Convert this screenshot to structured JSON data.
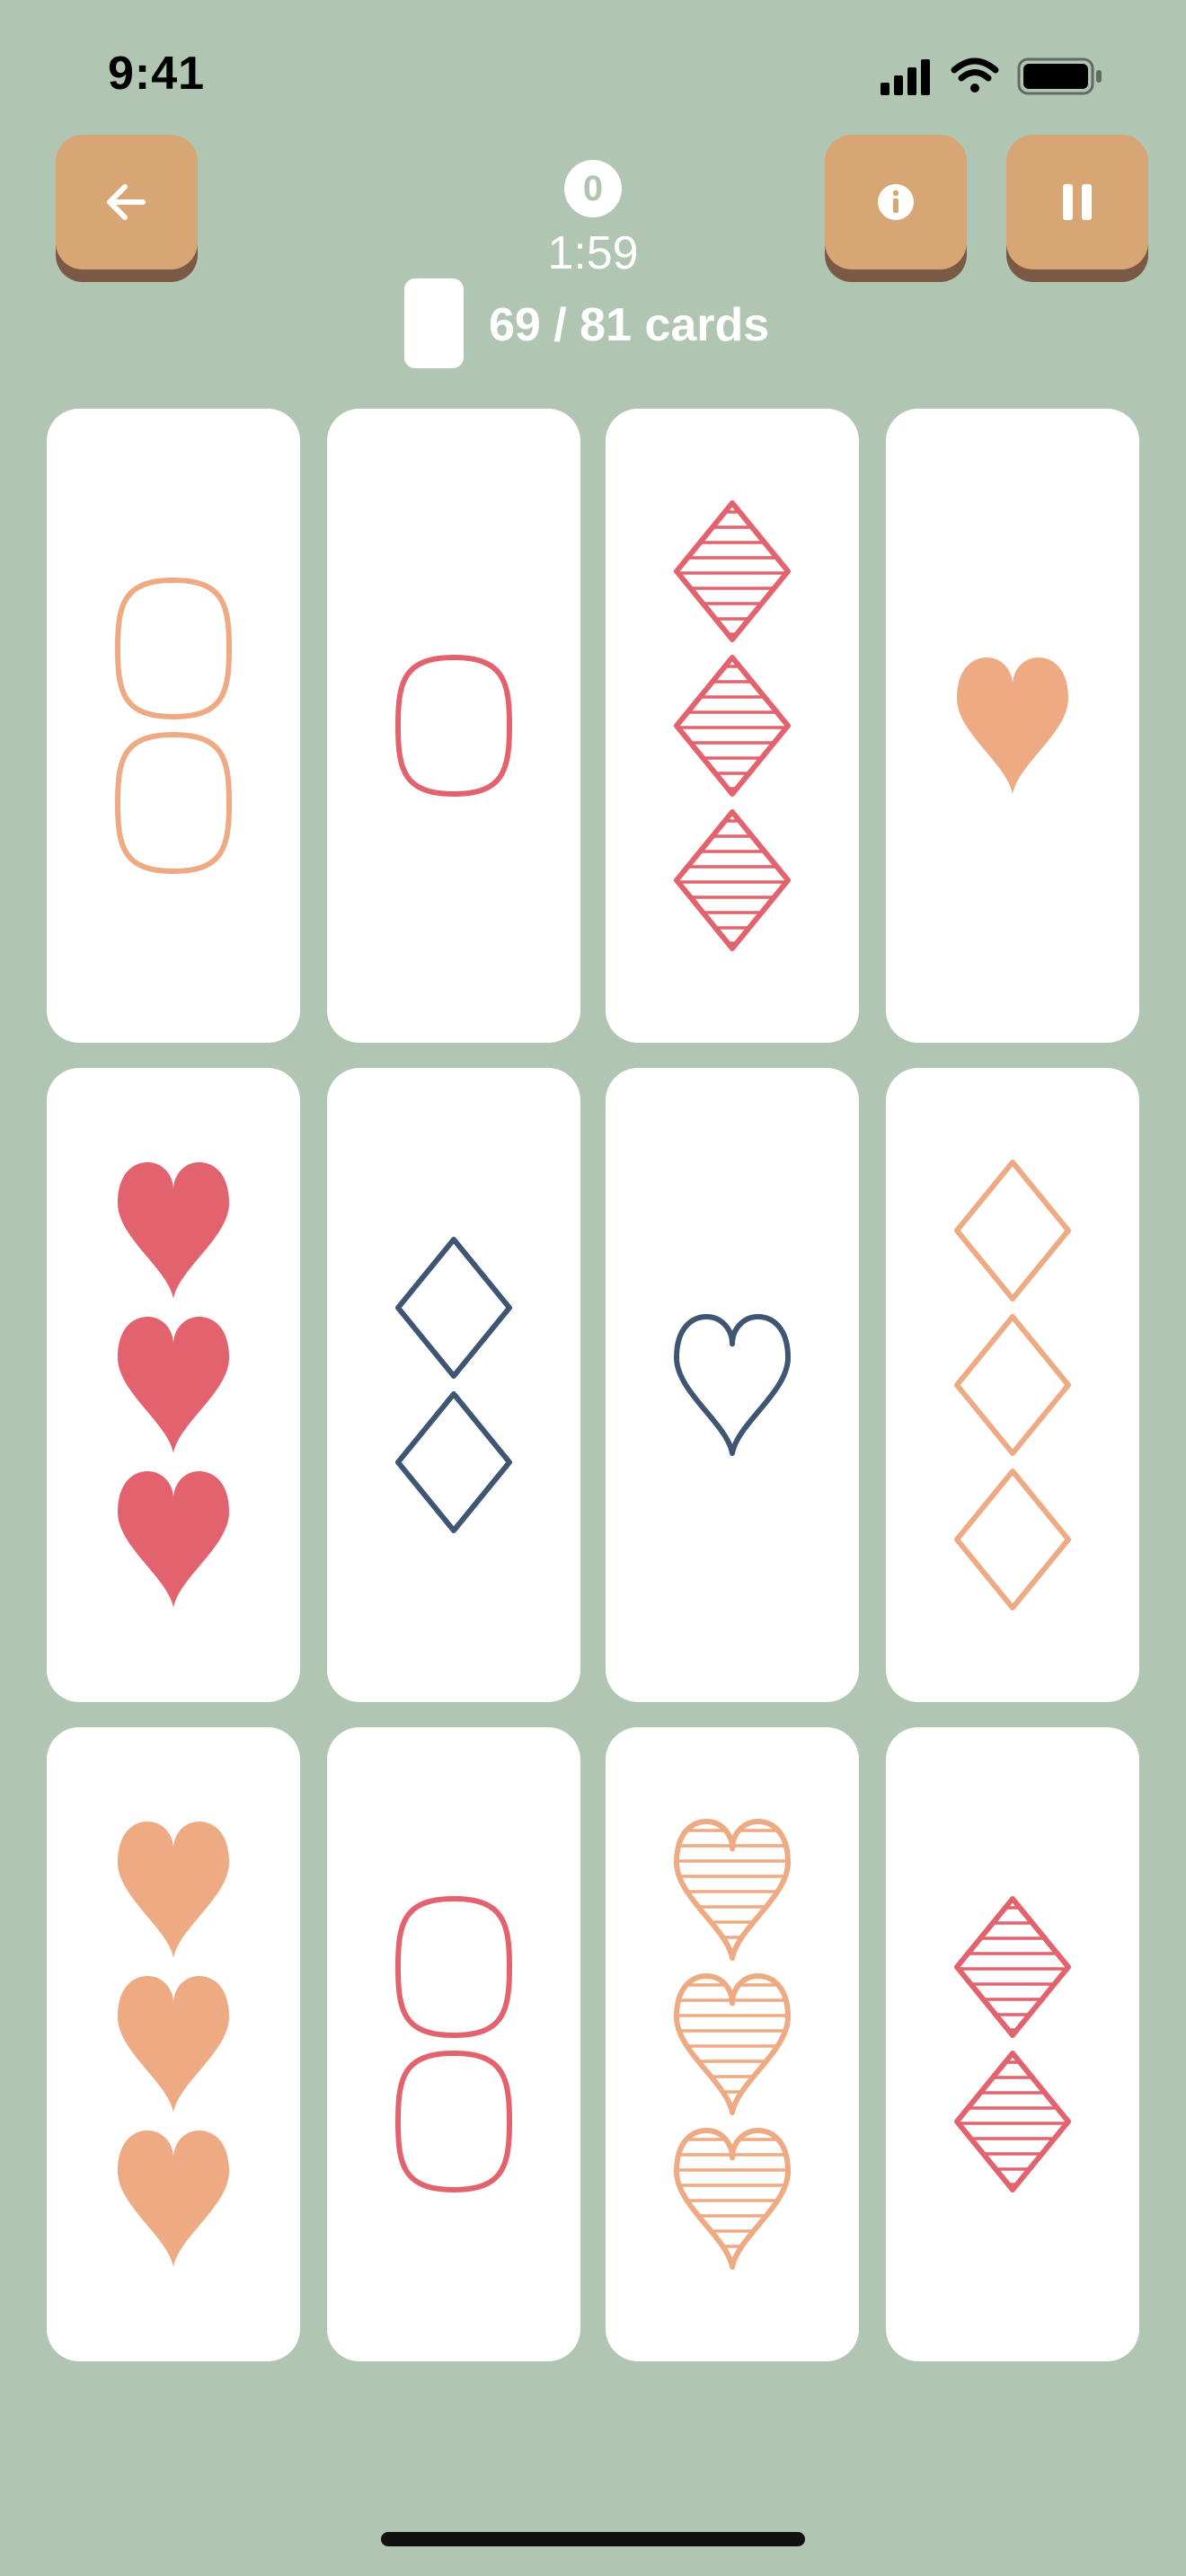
{
  "status_bar": {
    "time": "9:41"
  },
  "header": {
    "back_button": {
      "icon": "arrow-left-icon"
    },
    "info_button": {
      "icon": "info-icon"
    },
    "pause_button": {
      "icon": "pause-icon"
    },
    "score": "0",
    "timer": "1:59",
    "deck_count": "69 / 81 cards"
  },
  "colors": {
    "background": "#b0c5b2",
    "button": "#d8a574",
    "peach": "#eeaa82",
    "red": "#e2636e",
    "navy": "#3e5574"
  },
  "cards": [
    {
      "count": 2,
      "shape": "oval",
      "fill": "outline",
      "color": "peach"
    },
    {
      "count": 1,
      "shape": "oval",
      "fill": "outline",
      "color": "red"
    },
    {
      "count": 3,
      "shape": "diamond",
      "fill": "striped",
      "color": "red"
    },
    {
      "count": 1,
      "shape": "heart",
      "fill": "solid",
      "color": "peach"
    },
    {
      "count": 3,
      "shape": "heart",
      "fill": "solid",
      "color": "red"
    },
    {
      "count": 2,
      "shape": "diamond",
      "fill": "outline",
      "color": "navy"
    },
    {
      "count": 1,
      "shape": "heart",
      "fill": "outline",
      "color": "navy"
    },
    {
      "count": 3,
      "shape": "diamond",
      "fill": "outline",
      "color": "peach"
    },
    {
      "count": 3,
      "shape": "heart",
      "fill": "solid",
      "color": "peach"
    },
    {
      "count": 2,
      "shape": "oval",
      "fill": "outline",
      "color": "red"
    },
    {
      "count": 3,
      "shape": "heart",
      "fill": "striped",
      "color": "peach"
    },
    {
      "count": 2,
      "shape": "diamond",
      "fill": "striped",
      "color": "red"
    }
  ]
}
